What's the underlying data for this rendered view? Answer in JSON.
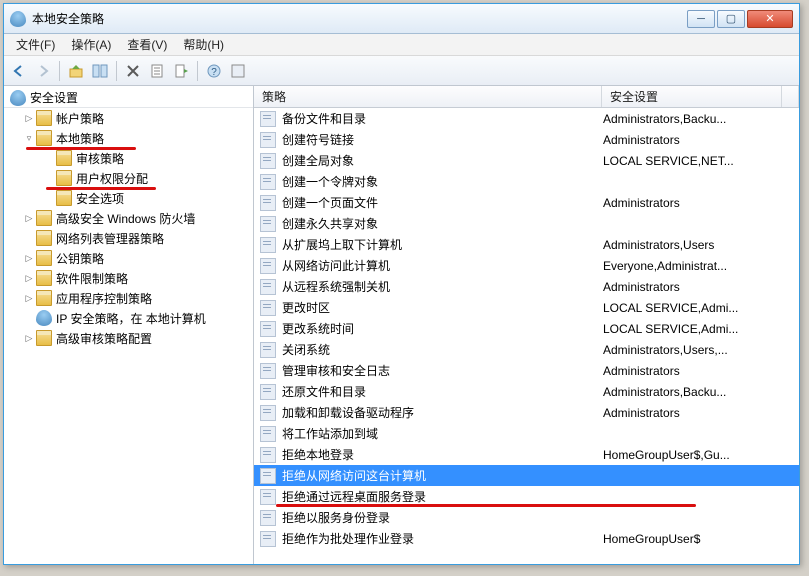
{
  "window_title": "本地安全策略",
  "menu": [
    "文件(F)",
    "操作(A)",
    "查看(V)",
    "帮助(H)"
  ],
  "tree": {
    "root": "安全设置",
    "items": [
      {
        "label": "帐户策略",
        "level": 1,
        "twisty": "▷",
        "redline": false
      },
      {
        "label": "本地策略",
        "level": 1,
        "twisty": "▿",
        "redline": true
      },
      {
        "label": "审核策略",
        "level": 2,
        "twisty": "",
        "redline": false
      },
      {
        "label": "用户权限分配",
        "level": 2,
        "twisty": "",
        "redline": true
      },
      {
        "label": "安全选项",
        "level": 2,
        "twisty": "",
        "redline": false
      },
      {
        "label": "高级安全 Windows 防火墙",
        "level": 1,
        "twisty": "▷",
        "redline": false
      },
      {
        "label": "网络列表管理器策略",
        "level": 1,
        "twisty": "",
        "redline": false
      },
      {
        "label": "公钥策略",
        "level": 1,
        "twisty": "▷",
        "redline": false
      },
      {
        "label": "软件限制策略",
        "level": 1,
        "twisty": "▷",
        "redline": false
      },
      {
        "label": "应用程序控制策略",
        "level": 1,
        "twisty": "▷",
        "redline": false
      },
      {
        "label": "IP 安全策略，在 本地计算机",
        "level": 1,
        "twisty": "",
        "icon": "shield",
        "redline": false
      },
      {
        "label": "高级审核策略配置",
        "level": 1,
        "twisty": "▷",
        "redline": false
      }
    ]
  },
  "list": {
    "headers": {
      "policy": "策略",
      "setting": "安全设置"
    },
    "rows": [
      {
        "policy": "备份文件和目录",
        "setting": "Administrators,Backu..."
      },
      {
        "policy": "创建符号链接",
        "setting": "Administrators"
      },
      {
        "policy": "创建全局对象",
        "setting": "LOCAL SERVICE,NET..."
      },
      {
        "policy": "创建一个令牌对象",
        "setting": ""
      },
      {
        "policy": "创建一个页面文件",
        "setting": "Administrators"
      },
      {
        "policy": "创建永久共享对象",
        "setting": ""
      },
      {
        "policy": "从扩展坞上取下计算机",
        "setting": "Administrators,Users"
      },
      {
        "policy": "从网络访问此计算机",
        "setting": "Everyone,Administrat..."
      },
      {
        "policy": "从远程系统强制关机",
        "setting": "Administrators"
      },
      {
        "policy": "更改时区",
        "setting": "LOCAL SERVICE,Admi..."
      },
      {
        "policy": "更改系统时间",
        "setting": "LOCAL SERVICE,Admi..."
      },
      {
        "policy": "关闭系统",
        "setting": "Administrators,Users,..."
      },
      {
        "policy": "管理审核和安全日志",
        "setting": "Administrators"
      },
      {
        "policy": "还原文件和目录",
        "setting": "Administrators,Backu..."
      },
      {
        "policy": "加载和卸载设备驱动程序",
        "setting": "Administrators"
      },
      {
        "policy": "将工作站添加到域",
        "setting": ""
      },
      {
        "policy": "拒绝本地登录",
        "setting": "HomeGroupUser$,Gu..."
      },
      {
        "policy": "拒绝从网络访问这台计算机",
        "setting": "",
        "selected": true
      },
      {
        "policy": "拒绝通过远程桌面服务登录",
        "setting": "",
        "redline": true
      },
      {
        "policy": "拒绝以服务身份登录",
        "setting": ""
      },
      {
        "policy": "拒绝作为批处理作业登录",
        "setting": "HomeGroupUser$"
      }
    ]
  }
}
